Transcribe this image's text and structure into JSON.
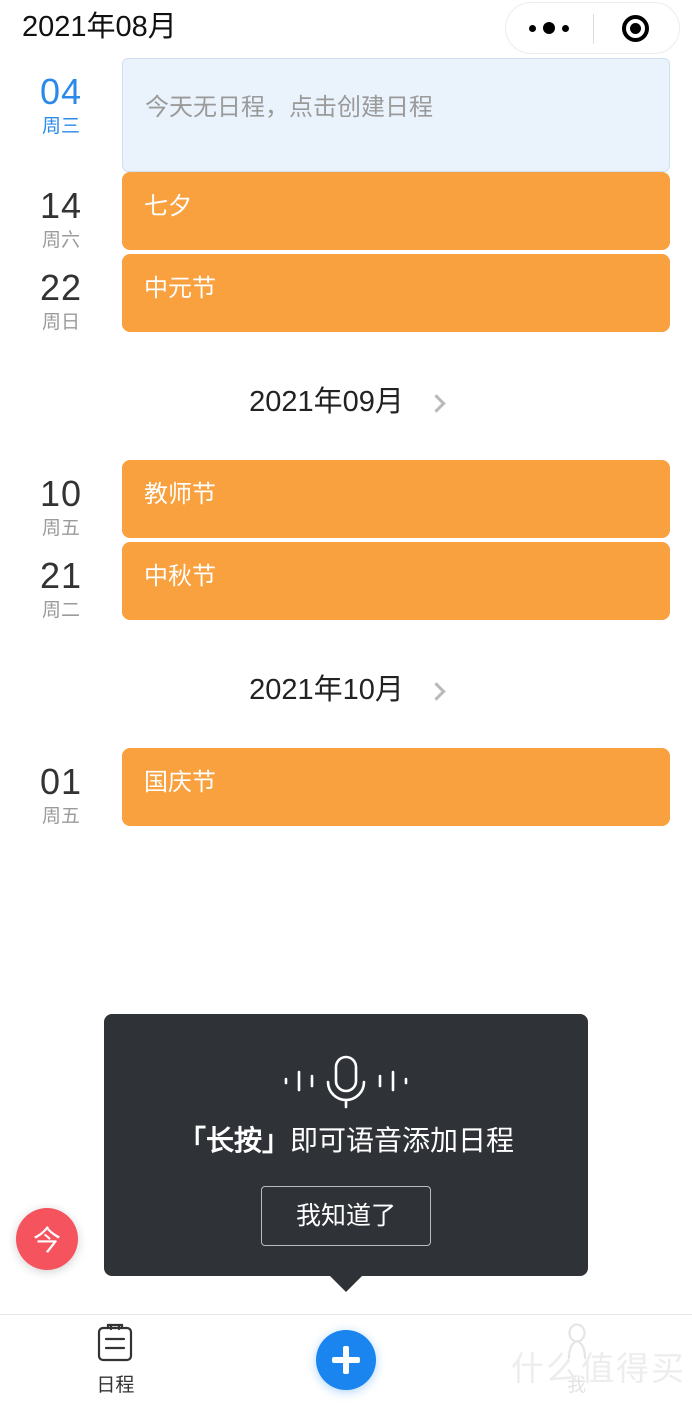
{
  "header": {
    "title": "2021年08月",
    "menu_icon": "more-dots-icon",
    "target_icon": "target-icon"
  },
  "sections": [
    {
      "month_label": null,
      "rows": [
        {
          "day": "04",
          "weekday": "周三",
          "today": true,
          "event": "今天无日程，点击创建日程",
          "empty": true
        },
        {
          "day": "14",
          "weekday": "周六",
          "today": false,
          "event": "七夕",
          "empty": false
        },
        {
          "day": "22",
          "weekday": "周日",
          "today": false,
          "event": "中元节",
          "empty": false
        }
      ]
    },
    {
      "month_label": "2021年09月",
      "rows": [
        {
          "day": "10",
          "weekday": "周五",
          "today": false,
          "event": "教师节",
          "empty": false
        },
        {
          "day": "21",
          "weekday": "周二",
          "today": false,
          "event": "中秋节",
          "empty": false
        }
      ]
    },
    {
      "month_label": "2021年10月",
      "rows": [
        {
          "day": "01",
          "weekday": "周五",
          "today": false,
          "event": "国庆节",
          "empty": false
        }
      ]
    }
  ],
  "today_button": {
    "label": "今"
  },
  "tooltip": {
    "icon": "microphone-icon",
    "title_strong": "「长按」",
    "title_rest": "即可语音添加日程",
    "button_label": "我知道了"
  },
  "bottom_nav": {
    "items": [
      {
        "label": "日程",
        "icon": "schedule-clipboard-icon"
      },
      {
        "label": "",
        "icon": "plus-icon"
      },
      {
        "label": "我",
        "icon": "person-icon"
      }
    ]
  },
  "watermark": {
    "text": "什么值得买"
  },
  "colors": {
    "event_orange": "#F9A03F",
    "today_blue": "#2B8AE8",
    "empty_box_bg": "#EAF2FB",
    "empty_box_border": "#CFE0F2",
    "fab_blue": "#1A84EF",
    "today_fab_red": "#F5535E",
    "tooltip_bg": "#2F3338"
  }
}
